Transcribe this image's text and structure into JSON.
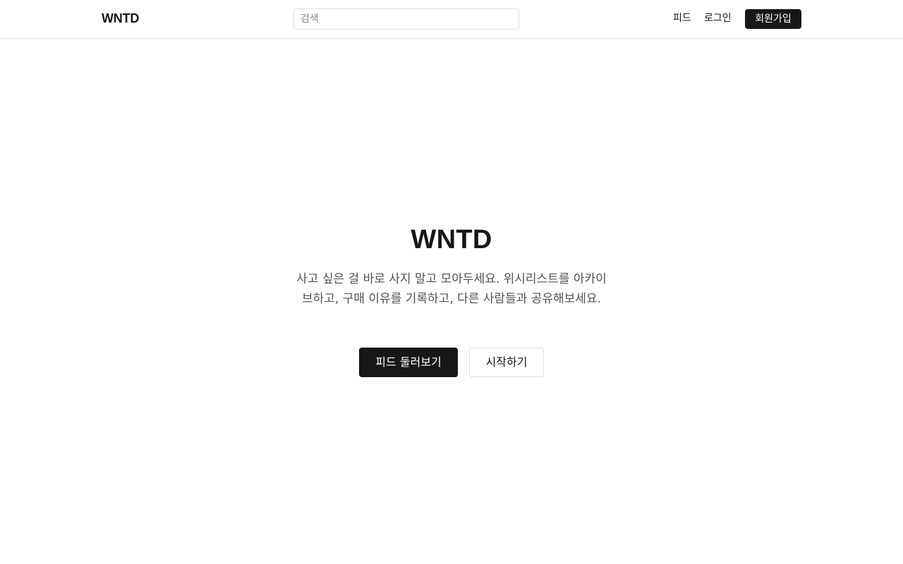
{
  "header": {
    "logo": "WNTD",
    "search": {
      "placeholder": "검색",
      "value": ""
    },
    "nav": {
      "feed": "피드",
      "login": "로그인",
      "signup": "회원가입"
    }
  },
  "hero": {
    "title": "WNTD",
    "description": "사고 싶은 걸 바로 사지 말고 모아두세요. 위시리스트를 아카이브하고, 구매 이유를 기록하고, 다른 사람들과 공유해보세요.",
    "primary_button": "피드 둘러보기",
    "secondary_button": "시작하기"
  },
  "colors": {
    "primary": "#171717",
    "background": "#ffffff",
    "muted_text": "#525252",
    "border": "#e5e5e5"
  }
}
